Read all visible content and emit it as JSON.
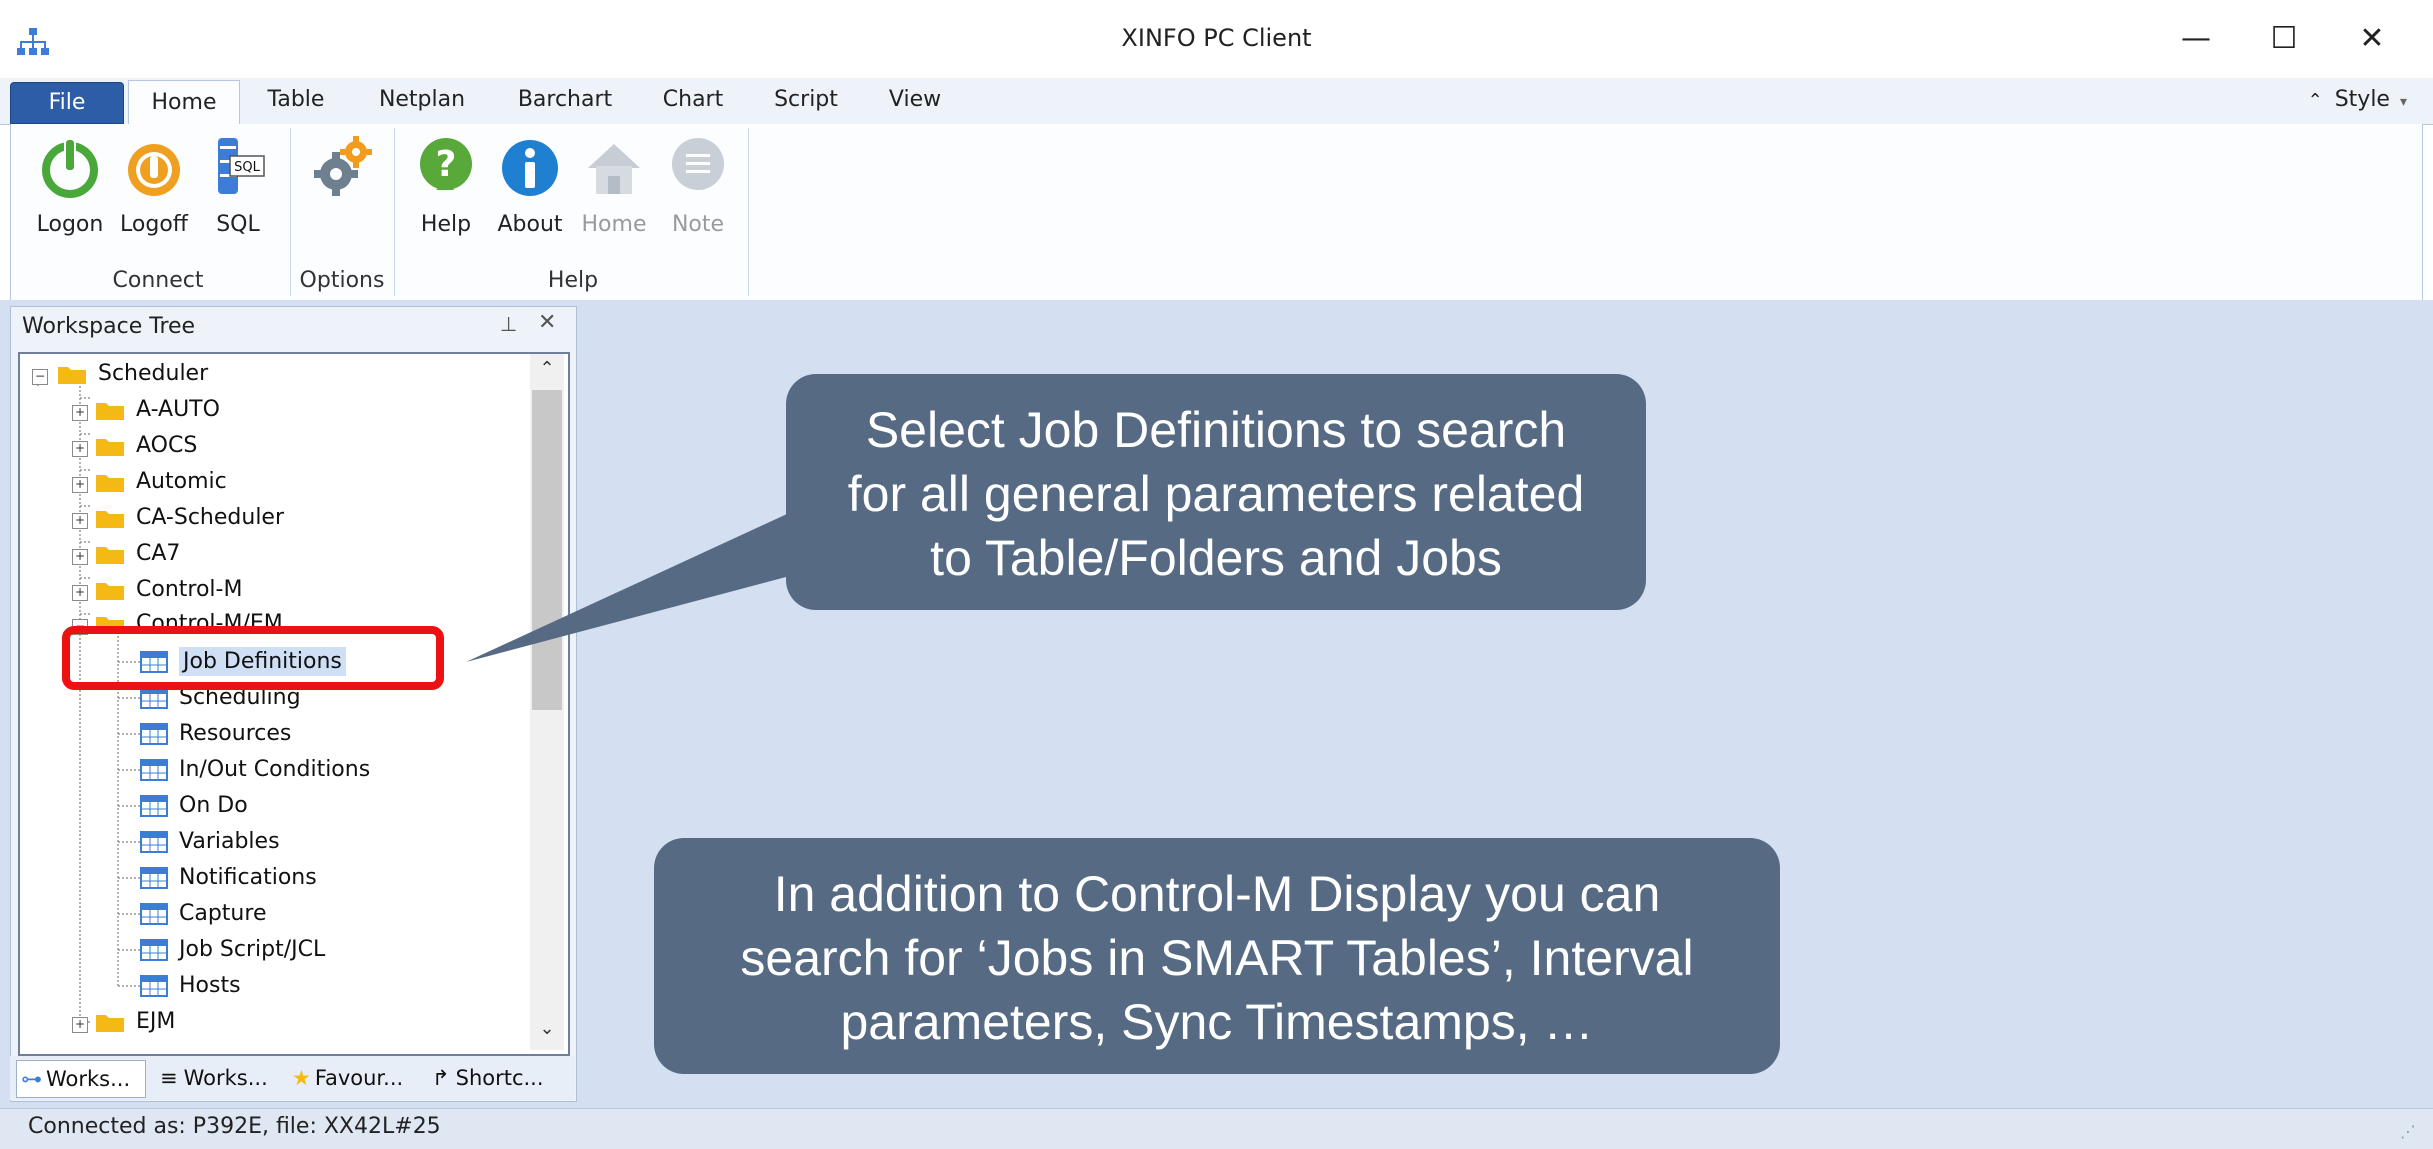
{
  "window": {
    "title": "XINFO PC Client",
    "minimize_glyph": "—",
    "maximize_glyph": "☐",
    "close_glyph": "✕"
  },
  "ribbon_tabs": [
    "File",
    "Home",
    "Table",
    "Netplan",
    "Barchart",
    "Chart",
    "Script",
    "View"
  ],
  "style_menu": {
    "label": "Style",
    "icon": "chevron-up-icon"
  },
  "ribbon_groups": {
    "connect": {
      "label": "Connect",
      "buttons": [
        {
          "label": "Logon",
          "icon": "power-green-icon"
        },
        {
          "label": "Logoff",
          "icon": "power-orange-icon"
        },
        {
          "label": "SQL",
          "icon": "sql-database-icon"
        }
      ]
    },
    "options": {
      "label": "Options",
      "buttons": [
        {
          "label": "",
          "icon": "gears-icon"
        }
      ]
    },
    "help": {
      "label": "Help",
      "buttons": [
        {
          "label": "Help",
          "icon": "question-icon"
        },
        {
          "label": "About",
          "icon": "info-icon"
        },
        {
          "label": "Home",
          "icon": "home-icon",
          "disabled": true
        },
        {
          "label": "Note",
          "icon": "note-icon",
          "disabled": true
        }
      ]
    }
  },
  "workspace_tree": {
    "title": "Workspace Tree",
    "root": "Scheduler",
    "folders": [
      "A-AUTO",
      "AOCS",
      "Automic",
      "CA-Scheduler",
      "CA7",
      "Control-M",
      "Control-M/EM"
    ],
    "expanded_children": [
      "Job Definitions",
      "Scheduling",
      "Resources",
      "In/Out Conditions",
      "On Do",
      "Variables",
      "Notifications",
      "Capture",
      "Job Script/JCL",
      "Hosts"
    ],
    "after": [
      "EJM"
    ],
    "selected": "Job Definitions"
  },
  "bottom_tabs": [
    "Works...",
    "Works...",
    "Favour...",
    "Shortc..."
  ],
  "status": "Connected as: P392E, file: XX42L#25",
  "callouts": {
    "first": [
      "Select Job Definitions to search",
      "for all general parameters related",
      "to Table/Folders and Jobs"
    ],
    "second": [
      "In addition to Control-M Display you can",
      "search for ‘Jobs in SMART Tables’, Interval",
      "parameters, Sync Timestamps, …"
    ]
  },
  "colors": {
    "accent": "#2c5da6",
    "callout": "#566b83",
    "highlight": "#ee1111",
    "workspace": "#d4e0f1"
  }
}
